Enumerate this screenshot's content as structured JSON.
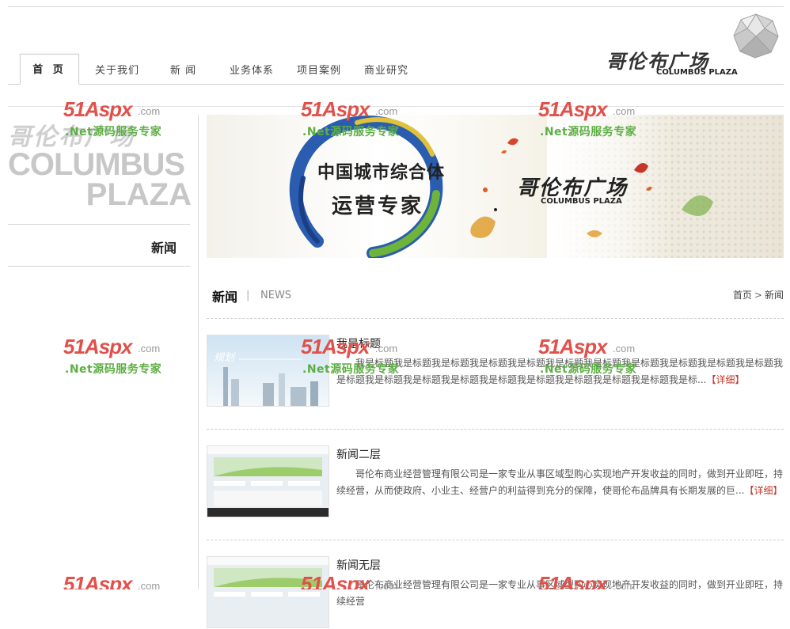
{
  "nav": {
    "tabs": [
      {
        "label": "首 页",
        "active": true
      },
      {
        "label": "关于我们"
      },
      {
        "label": "新 闻"
      },
      {
        "label": "业务体系"
      },
      {
        "label": "项目案例"
      },
      {
        "label": "商业研究"
      }
    ]
  },
  "logo": {
    "cn": "哥伦布广场",
    "en": "COLUMBUS PLAZA"
  },
  "sidebar": {
    "brand_cn": "哥伦布广场",
    "brand_en1": "COLUMBUS",
    "brand_en2": "PLAZA",
    "title": "新闻"
  },
  "banner": {
    "slogan_line1": "中国城市综合体",
    "slogan_line2": "运营专家",
    "brand_cn": "哥伦布广场",
    "brand_en": "COLUMBUS PLAZA"
  },
  "section": {
    "title": "新闻",
    "separator": "|",
    "title_en": "NEWS",
    "breadcrumb": {
      "home": "首页",
      "sep": ">",
      "current": "新闻"
    }
  },
  "news": [
    {
      "title": "我是标题",
      "desc": "我是标题我是标题我是标题我是标题我是标题我是标题我是标题我是标题我是标题我是标题我是标题我是标题我是标题我是标题我是标题我是标题我是标题我是标题我是标题我是标题我是标...",
      "more": "【详细】"
    },
    {
      "title": "新闻二层",
      "desc": "哥伦布商业经营管理有限公司是一家专业从事区域型购心实现地产开发收益的同时，做到开业即旺，持续经营，从而使政府、小业主、经营户的利益得到充分的保障，使哥伦布品牌具有长期发展的巨...",
      "more": "【详细】"
    },
    {
      "title": "新闻无层",
      "desc": "哥伦布商业经营管理有限公司是一家专业从事区域型购心实现地产开发收益的同时，做到开业即旺，持续经营",
      "more": ""
    }
  ],
  "watermark": {
    "brand": "51Aspx",
    "domain": ".com",
    "tagline": ".Net源码服务专家"
  },
  "colors": {
    "more_link": "#c0392b",
    "watermark_red": "#e2504a",
    "watermark_green": "#5dae44"
  }
}
